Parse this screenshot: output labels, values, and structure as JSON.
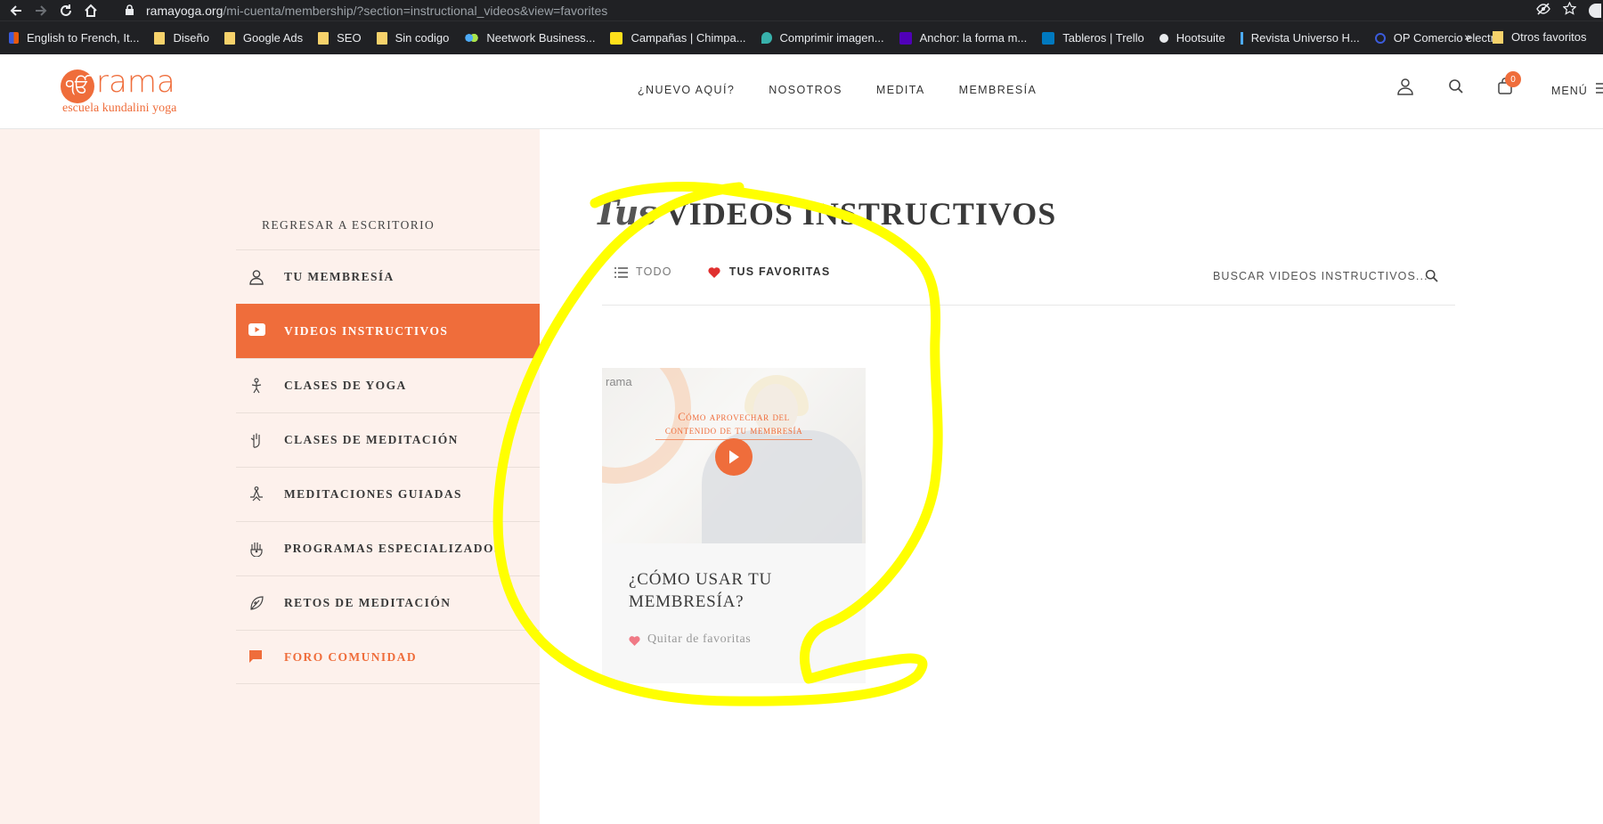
{
  "browser": {
    "url_host": "ramayoga.org",
    "url_path": "/mi-cuenta/membership/?section=instructional_videos&view=favorites",
    "bookmarks": [
      {
        "label": "English to French, It..."
      },
      {
        "label": "Diseño"
      },
      {
        "label": "Google Ads"
      },
      {
        "label": "SEO"
      },
      {
        "label": "Sin codigo"
      },
      {
        "label": "Neetwork Business..."
      },
      {
        "label": "Campañas | Chimpa..."
      },
      {
        "label": "Comprimir imagen..."
      },
      {
        "label": "Anchor: la forma m..."
      },
      {
        "label": "Tableros | Trello"
      },
      {
        "label": "Hootsuite"
      },
      {
        "label": "Revista Universo H..."
      },
      {
        "label": "OP Comercio electr..."
      }
    ],
    "more": "»",
    "other_bookmarks": "Otros favoritos"
  },
  "header": {
    "logo_name": "rama",
    "logo_tagline": "escuela kundalini yoga",
    "nav": [
      "¿NUEVO AQUÍ?",
      "NOSOTROS",
      "MEDITA",
      "MEMBRESÍA"
    ],
    "cart_count": "0",
    "menu_label": "MENÚ"
  },
  "sidebar": {
    "back_label": "REGRESAR A ESCRITORIO",
    "items": [
      {
        "label": "TU MEMBRESÍA",
        "icon": "user-icon"
      },
      {
        "label": "VIDEOS INSTRUCTIVOS",
        "icon": "youtube-icon",
        "active": true
      },
      {
        "label": "CLASES DE YOGA",
        "icon": "yoga-pose-icon"
      },
      {
        "label": "CLASES DE MEDITACIÓN",
        "icon": "mudra-hand-icon"
      },
      {
        "label": "MEDITACIONES GUIADAS",
        "icon": "meditation-icon"
      },
      {
        "label": "PROGRAMAS ESPECIALIZADOS",
        "icon": "hamsa-hand-icon"
      },
      {
        "label": "RETOS DE MEDITACIÓN",
        "icon": "leaf-icon"
      },
      {
        "label": "FORO COMUNIDAD",
        "icon": "chat-icon"
      }
    ]
  },
  "main": {
    "title_script": "Tus",
    "title_main": "VIDEOS INSTRUCTIVOS",
    "filter_all": "TODO",
    "filter_favorites": "TUS FAVORITAS",
    "search_placeholder": "BUSCAR VIDEOS INSTRUCTIVOS...",
    "card": {
      "thumb_brand": "rama",
      "thumb_caption_line1": "Cómo aprovechar del",
      "thumb_caption_line2": "contenido de tu membresía",
      "title": "¿CÓMO USAR TU MEMBRESÍA?",
      "favorite_label": "Quitar de favoritas"
    }
  },
  "colors": {
    "accent": "#ef6d3b",
    "sidebar_bg": "#fdf1ec",
    "annotation": "#ffff00",
    "heart": "#e0302f"
  }
}
